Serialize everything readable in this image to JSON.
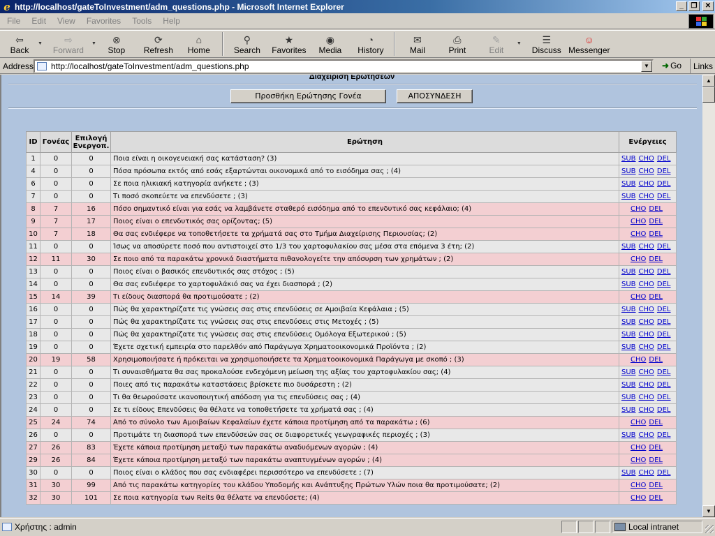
{
  "window": {
    "title": "http://localhost/gateToInvestment/adm_questions.php - Microsoft Internet Explorer"
  },
  "menu": [
    "File",
    "Edit",
    "View",
    "Favorites",
    "Tools",
    "Help"
  ],
  "toolbar": {
    "back": "Back",
    "forward": "Forward",
    "stop": "Stop",
    "refresh": "Refresh",
    "home": "Home",
    "search": "Search",
    "favorites": "Favorites",
    "media": "Media",
    "history": "History",
    "mail": "Mail",
    "print": "Print",
    "edit": "Edit",
    "discuss": "Discuss",
    "messenger": "Messenger"
  },
  "address": {
    "label": "Address",
    "url": "http://localhost/gateToInvestment/adm_questions.php",
    "go": "Go",
    "links": "Links"
  },
  "page": {
    "heading": "Διαχείριση Ερωτήσεων",
    "add_parent_button": "Προσθήκη Ερώτησης Γονέα",
    "logout_button": "ΑΠΟΣΥΝΔΕΣΗ",
    "table": {
      "headers": [
        "ID",
        "Γονέας",
        "Επιλογή Ενεργοπ.",
        "Ερώτηση",
        "Ενέργειες"
      ],
      "action_labels": {
        "sub": "SUB",
        "cho": "CHO",
        "del": "DEL"
      },
      "rows": [
        {
          "id": "1",
          "parent": "0",
          "choice": "0",
          "question": "Ποια είναι η οικογενειακή σας κατάσταση? (3)",
          "sub": true,
          "pink": false
        },
        {
          "id": "4",
          "parent": "0",
          "choice": "0",
          "question": "Πόσα πρόσωπα εκτός από εσάς εξαρτώνται οικονομικά από το εισόδημα σας ; (4)",
          "sub": true,
          "pink": false
        },
        {
          "id": "6",
          "parent": "0",
          "choice": "0",
          "question": "Σε ποια ηλικιακή κατηγορία ανήκετε ; (3)",
          "sub": true,
          "pink": false
        },
        {
          "id": "7",
          "parent": "0",
          "choice": "0",
          "question": "Τι ποσό σκοπεύετε να επενδύσετε ; (3)",
          "sub": true,
          "pink": false
        },
        {
          "id": "8",
          "parent": "7",
          "choice": "16",
          "question": "Πόσο σημαντικό είναι για εσάς να λαμβάνετε σταθερό εισόδημα από το επενδυτικό σας κεφάλαιο; (4)",
          "sub": false,
          "pink": true
        },
        {
          "id": "9",
          "parent": "7",
          "choice": "17",
          "question": "Ποιος είναι ο επενδυτικός σας ορίζοντας; (5)",
          "sub": false,
          "pink": true
        },
        {
          "id": "10",
          "parent": "7",
          "choice": "18",
          "question": "Θα σας ενδιέφερε να τοποθετήσετε τα χρήματά σας στο Τμήμα Διαχείρισης Περιουσίας; (2)",
          "sub": false,
          "pink": true
        },
        {
          "id": "11",
          "parent": "0",
          "choice": "0",
          "question": "Ίσως να αποσύρετε ποσό που αντιστοιχεί στο 1/3 του χαρτοφυλακίου σας μέσα στα επόμενα 3 έτη; (2)",
          "sub": true,
          "pink": false
        },
        {
          "id": "12",
          "parent": "11",
          "choice": "30",
          "question": "Σε ποιο από τα παρακάτω χρονικά διαστήματα πιθανολογείτε την απόσυρση των χρημάτων ; (2)",
          "sub": false,
          "pink": true
        },
        {
          "id": "13",
          "parent": "0",
          "choice": "0",
          "question": "Ποιος είναι ο βασικός επενδυτικός σας στόχος ; (5)",
          "sub": true,
          "pink": false
        },
        {
          "id": "14",
          "parent": "0",
          "choice": "0",
          "question": "Θα σας ενδιέφερε το χαρτοφυλάκιό σας να έχει διασπορά ; (2)",
          "sub": true,
          "pink": false
        },
        {
          "id": "15",
          "parent": "14",
          "choice": "39",
          "question": "Τι είδους διασπορά θα προτιμούσατε ; (2)",
          "sub": false,
          "pink": true
        },
        {
          "id": "16",
          "parent": "0",
          "choice": "0",
          "question": "Πώς θα χαρακτηρίζατε τις γνώσεις σας στις επενδύσεις σε Αμοιβαία Κεφάλαια ; (5)",
          "sub": true,
          "pink": false
        },
        {
          "id": "17",
          "parent": "0",
          "choice": "0",
          "question": "Πώς θα χαρακτηρίζατε τις γνώσεις σας στις επενδύσεις στις Μετοχές ; (5)",
          "sub": true,
          "pink": false
        },
        {
          "id": "18",
          "parent": "0",
          "choice": "0",
          "question": "Πώς θα χαρακτηρίζατε τις γνώσεις σας στις επενδύσεις Ομόλογα Εξωτερικού ; (5)",
          "sub": true,
          "pink": false
        },
        {
          "id": "19",
          "parent": "0",
          "choice": "0",
          "question": "Έχετε σχετική εμπειρία στο παρελθόν από Παράγωγα Χρηματοοικονομικά Προϊόντα ; (2)",
          "sub": true,
          "pink": false
        },
        {
          "id": "20",
          "parent": "19",
          "choice": "58",
          "question": "Χρησιμοποιήσατε ή πρόκειται να χρησιμοποιήσετε τα Χρηματοοικονομικά Παράγωγα με σκοπό ; (3)",
          "sub": false,
          "pink": true
        },
        {
          "id": "21",
          "parent": "0",
          "choice": "0",
          "question": "Τι συναισθήματα θα σας προκαλούσε ενδεχόμενη μείωση της αξίας του χαρτοφυλακίου σας; (4)",
          "sub": true,
          "pink": false
        },
        {
          "id": "22",
          "parent": "0",
          "choice": "0",
          "question": "Ποιες από τις παρακάτω καταστάσεις βρίσκετε πιο δυσάρεστη ; (2)",
          "sub": true,
          "pink": false
        },
        {
          "id": "23",
          "parent": "0",
          "choice": "0",
          "question": "Τι θα θεωρούσατε ικανοποιητική απόδοση για τις επενδύσεις σας ; (4)",
          "sub": true,
          "pink": false
        },
        {
          "id": "24",
          "parent": "0",
          "choice": "0",
          "question": "Σε τι είδους Επενδύσεις θα θέλατε να τοποθετήσετε τα χρήματά σας ; (4)",
          "sub": true,
          "pink": false
        },
        {
          "id": "25",
          "parent": "24",
          "choice": "74",
          "question": "Από το σύνολο των Αμοιβαίων Κεφαλαίων έχετε κάποια προτίμηση από τα παρακάτω ; (6)",
          "sub": false,
          "pink": true
        },
        {
          "id": "26",
          "parent": "0",
          "choice": "0",
          "question": "Προτιμάτε τη διασπορά των επενδύσεών σας σε διαφορετικές γεωγραφικές περιοχές ; (3)",
          "sub": true,
          "pink": false
        },
        {
          "id": "27",
          "parent": "26",
          "choice": "83",
          "question": "Έχετε κάποια προτίμηση μεταξύ των παρακάτω αναδυόμενων αγορών ; (4)",
          "sub": false,
          "pink": true
        },
        {
          "id": "29",
          "parent": "26",
          "choice": "84",
          "question": "Έχετε κάποια προτίμηση μεταξύ των παρακάτω αναπτυγμένων αγορών ; (4)",
          "sub": false,
          "pink": true
        },
        {
          "id": "30",
          "parent": "0",
          "choice": "0",
          "question": "Ποιος είναι ο κλάδος που σας ενδιαφέρει περισσότερο να επενδύσετε ; (7)",
          "sub": true,
          "pink": false
        },
        {
          "id": "31",
          "parent": "30",
          "choice": "99",
          "question": "Από τις παρακάτω κατηγορίες του κλάδου Υποδομής και Ανάπτυξης Πρώτων Υλών ποια θα προτιμούσατε; (2)",
          "sub": false,
          "pink": true
        },
        {
          "id": "32",
          "parent": "30",
          "choice": "101",
          "question": "Σε ποια κατηγορία των Reits θα θέλατε να επενδύσετε; (4)",
          "sub": false,
          "pink": true
        }
      ]
    }
  },
  "status": {
    "text": "Χρήστης : admin",
    "zone": "Local intranet"
  }
}
